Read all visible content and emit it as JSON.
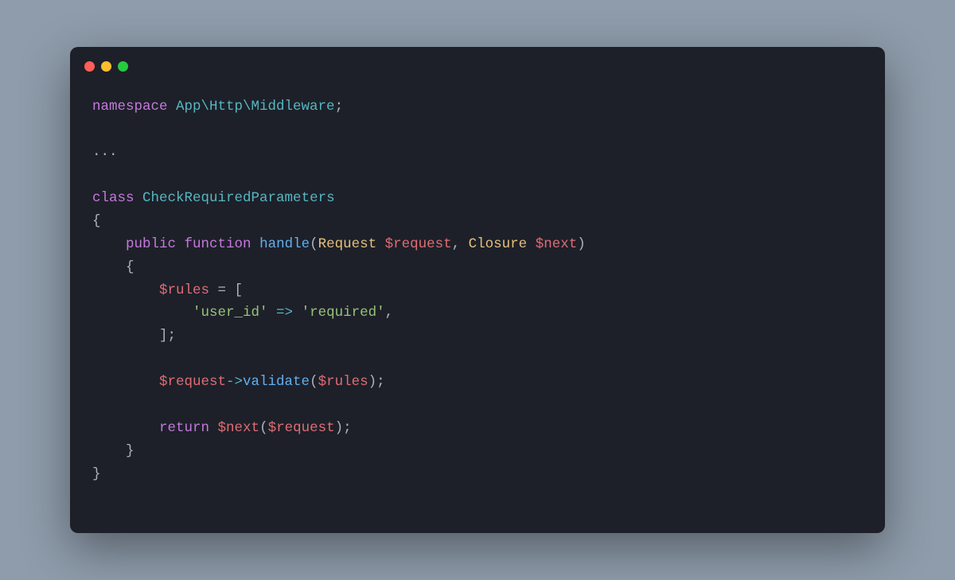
{
  "code": {
    "kw_namespace": "namespace",
    "ns_path": "App\\Http\\Middleware",
    "semi": ";",
    "ellipsis": "...",
    "kw_class": "class",
    "class_name": "CheckRequiredParameters",
    "brace_open": "{",
    "brace_close": "}",
    "kw_public": "public",
    "kw_function": "function",
    "fn_handle": "handle",
    "paren_open": "(",
    "paren_close": ")",
    "type_request": "Request",
    "var_request": "$request",
    "comma_sp": ", ",
    "type_closure": "Closure",
    "var_next": "$next",
    "var_rules": "$rules",
    "eq": " = ",
    "bracket_open": "[",
    "bracket_close": "]",
    "str_userid": "'user_id'",
    "arrow_assoc": " => ",
    "str_required": "'required'",
    "comma": ",",
    "obj_arrow": "->",
    "m_validate": "validate",
    "kw_return": "return"
  },
  "colors": {
    "keyword": "#c678dd",
    "classname": "#56b6c2",
    "type": "#e5c07b",
    "function": "#61afef",
    "variable": "#e06c75",
    "string": "#98c379",
    "punct": "#abb2bf",
    "bg": "#1d2029",
    "page_bg": "#8e9cab"
  }
}
